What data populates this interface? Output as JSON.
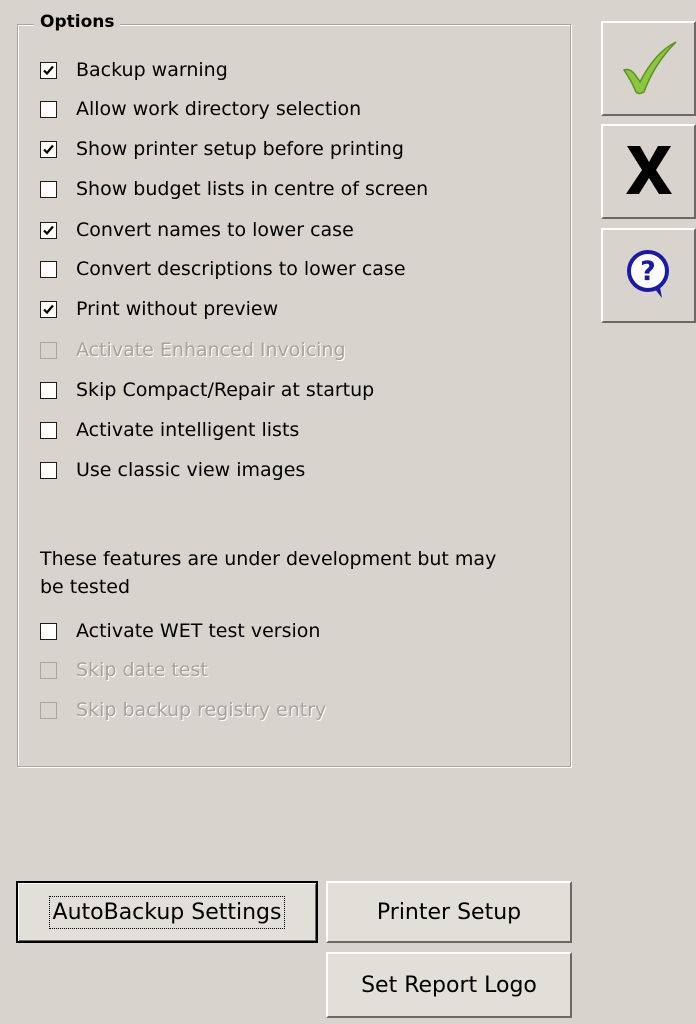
{
  "options_group": {
    "title": "Options",
    "items": [
      {
        "label": "Backup warning",
        "checked": true,
        "enabled": true
      },
      {
        "label": "Allow work directory selection",
        "checked": false,
        "enabled": true
      },
      {
        "label": "Show printer setup before printing",
        "checked": true,
        "enabled": true
      },
      {
        "label": "Show budget lists in centre of screen",
        "checked": false,
        "enabled": true
      },
      {
        "label": "Convert names to lower case",
        "checked": true,
        "enabled": true
      },
      {
        "label": "Convert descriptions to lower case",
        "checked": false,
        "enabled": true
      },
      {
        "label": "Print without preview",
        "checked": true,
        "enabled": true
      },
      {
        "label": "Activate Enhanced Invoicing",
        "checked": false,
        "enabled": false
      },
      {
        "label": "Skip Compact/Repair at startup",
        "checked": false,
        "enabled": true
      },
      {
        "label": "Activate intelligent lists",
        "checked": false,
        "enabled": true
      },
      {
        "label": "Use classic view images",
        "checked": false,
        "enabled": true
      }
    ],
    "dev_note": "These features are under development but may be tested",
    "dev_items": [
      {
        "label": "Activate WET test version",
        "checked": false,
        "enabled": true
      },
      {
        "label": "Skip date test",
        "checked": false,
        "enabled": false
      },
      {
        "label": "Skip backup registry entry",
        "checked": false,
        "enabled": false
      }
    ]
  },
  "side_buttons": {
    "ok_icon": "checkmark-icon",
    "cancel_icon": "x-icon",
    "help_icon": "question-icon",
    "colors": {
      "ok": "#8cc63f",
      "cancel": "#000000",
      "help": "#1a1aa6"
    }
  },
  "buttons": {
    "autobackup": "AutoBackup Settings",
    "printer_setup": "Printer Setup",
    "report_logo": "Set Report Logo"
  }
}
